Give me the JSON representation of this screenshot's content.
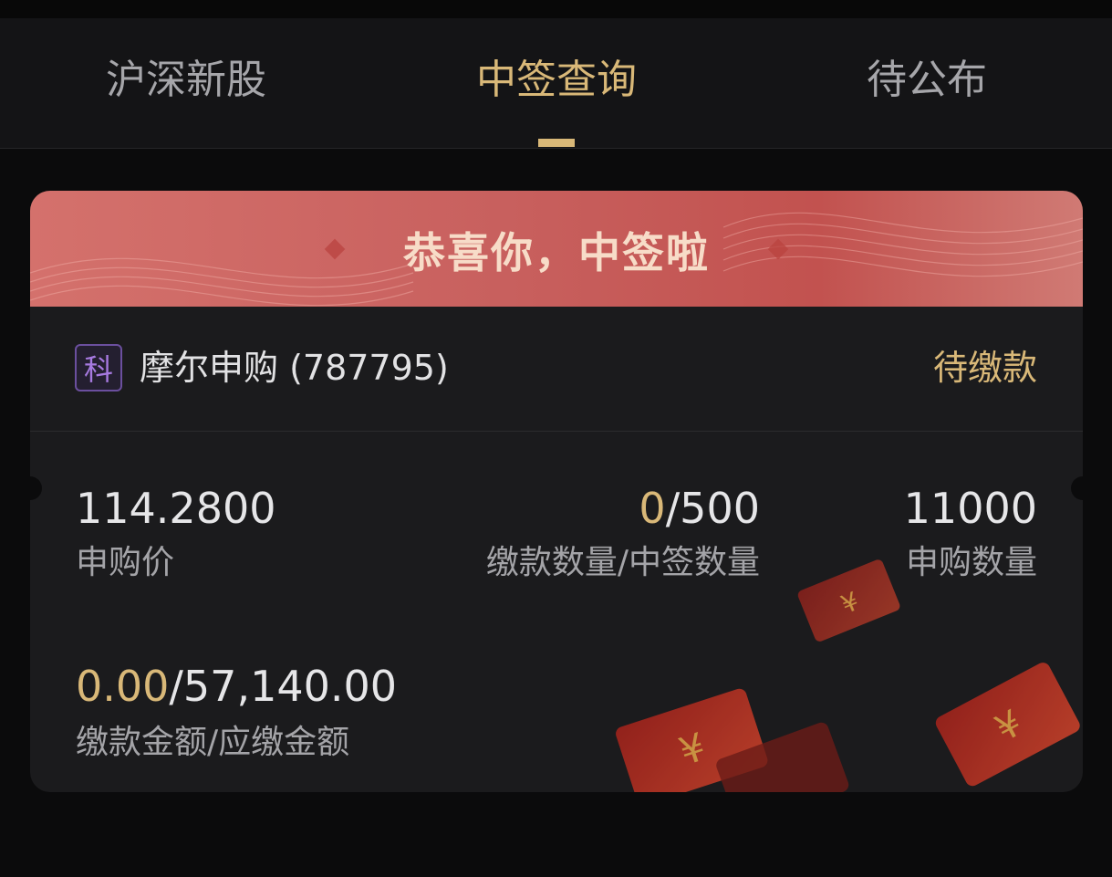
{
  "tabs": [
    {
      "label": "沪深新股",
      "active": false
    },
    {
      "label": "中签查询",
      "active": true
    },
    {
      "label": "待公布",
      "active": false
    }
  ],
  "banner": {
    "title": "恭喜你，中签啦"
  },
  "stock": {
    "board_badge": "科",
    "name": "摩尔申购 (787795)",
    "status": "待缴款"
  },
  "metrics": {
    "price": {
      "value": "114.2800",
      "label": "申购价"
    },
    "quantity": {
      "paid": "0",
      "sep_total": "/500",
      "label": "缴款数量/中签数量"
    },
    "subscribe": {
      "value": "11000",
      "label": "申购数量"
    },
    "amount": {
      "paid": "0.00",
      "sep_total": "/57,140.00",
      "label": "缴款金额/应缴金额"
    }
  },
  "colors": {
    "accent": "#d9b878",
    "banner": "#c8605e",
    "badge": "#a77ae0"
  }
}
